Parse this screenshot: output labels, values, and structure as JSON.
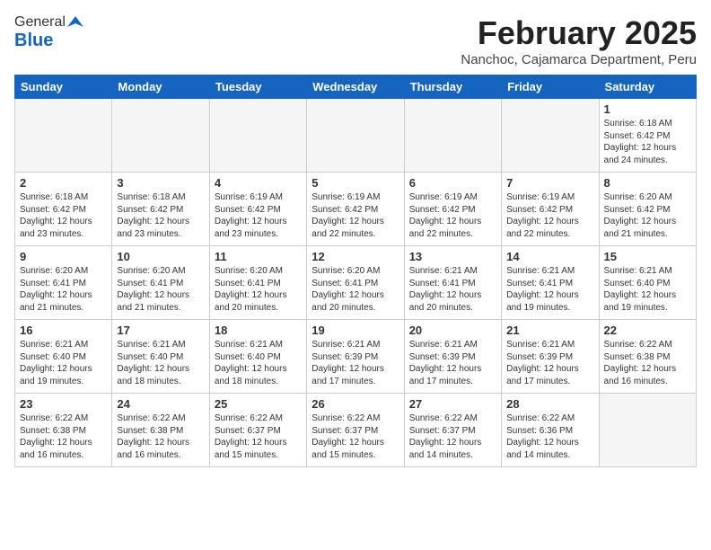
{
  "logo": {
    "general": "General",
    "blue": "Blue"
  },
  "header": {
    "month_title": "February 2025",
    "location": "Nanchoc, Cajamarca Department, Peru"
  },
  "weekdays": [
    "Sunday",
    "Monday",
    "Tuesday",
    "Wednesday",
    "Thursday",
    "Friday",
    "Saturday"
  ],
  "weeks": [
    [
      {
        "date": "",
        "info": ""
      },
      {
        "date": "",
        "info": ""
      },
      {
        "date": "",
        "info": ""
      },
      {
        "date": "",
        "info": ""
      },
      {
        "date": "",
        "info": ""
      },
      {
        "date": "",
        "info": ""
      },
      {
        "date": "1",
        "info": "Sunrise: 6:18 AM\nSunset: 6:42 PM\nDaylight: 12 hours and 24 minutes."
      }
    ],
    [
      {
        "date": "2",
        "info": "Sunrise: 6:18 AM\nSunset: 6:42 PM\nDaylight: 12 hours and 23 minutes."
      },
      {
        "date": "3",
        "info": "Sunrise: 6:18 AM\nSunset: 6:42 PM\nDaylight: 12 hours and 23 minutes."
      },
      {
        "date": "4",
        "info": "Sunrise: 6:19 AM\nSunset: 6:42 PM\nDaylight: 12 hours and 23 minutes."
      },
      {
        "date": "5",
        "info": "Sunrise: 6:19 AM\nSunset: 6:42 PM\nDaylight: 12 hours and 22 minutes."
      },
      {
        "date": "6",
        "info": "Sunrise: 6:19 AM\nSunset: 6:42 PM\nDaylight: 12 hours and 22 minutes."
      },
      {
        "date": "7",
        "info": "Sunrise: 6:19 AM\nSunset: 6:42 PM\nDaylight: 12 hours and 22 minutes."
      },
      {
        "date": "8",
        "info": "Sunrise: 6:20 AM\nSunset: 6:42 PM\nDaylight: 12 hours and 21 minutes."
      }
    ],
    [
      {
        "date": "9",
        "info": "Sunrise: 6:20 AM\nSunset: 6:41 PM\nDaylight: 12 hours and 21 minutes."
      },
      {
        "date": "10",
        "info": "Sunrise: 6:20 AM\nSunset: 6:41 PM\nDaylight: 12 hours and 21 minutes."
      },
      {
        "date": "11",
        "info": "Sunrise: 6:20 AM\nSunset: 6:41 PM\nDaylight: 12 hours and 20 minutes."
      },
      {
        "date": "12",
        "info": "Sunrise: 6:20 AM\nSunset: 6:41 PM\nDaylight: 12 hours and 20 minutes."
      },
      {
        "date": "13",
        "info": "Sunrise: 6:21 AM\nSunset: 6:41 PM\nDaylight: 12 hours and 20 minutes."
      },
      {
        "date": "14",
        "info": "Sunrise: 6:21 AM\nSunset: 6:41 PM\nDaylight: 12 hours and 19 minutes."
      },
      {
        "date": "15",
        "info": "Sunrise: 6:21 AM\nSunset: 6:40 PM\nDaylight: 12 hours and 19 minutes."
      }
    ],
    [
      {
        "date": "16",
        "info": "Sunrise: 6:21 AM\nSunset: 6:40 PM\nDaylight: 12 hours and 19 minutes."
      },
      {
        "date": "17",
        "info": "Sunrise: 6:21 AM\nSunset: 6:40 PM\nDaylight: 12 hours and 18 minutes."
      },
      {
        "date": "18",
        "info": "Sunrise: 6:21 AM\nSunset: 6:40 PM\nDaylight: 12 hours and 18 minutes."
      },
      {
        "date": "19",
        "info": "Sunrise: 6:21 AM\nSunset: 6:39 PM\nDaylight: 12 hours and 17 minutes."
      },
      {
        "date": "20",
        "info": "Sunrise: 6:21 AM\nSunset: 6:39 PM\nDaylight: 12 hours and 17 minutes."
      },
      {
        "date": "21",
        "info": "Sunrise: 6:21 AM\nSunset: 6:39 PM\nDaylight: 12 hours and 17 minutes."
      },
      {
        "date": "22",
        "info": "Sunrise: 6:22 AM\nSunset: 6:38 PM\nDaylight: 12 hours and 16 minutes."
      }
    ],
    [
      {
        "date": "23",
        "info": "Sunrise: 6:22 AM\nSunset: 6:38 PM\nDaylight: 12 hours and 16 minutes."
      },
      {
        "date": "24",
        "info": "Sunrise: 6:22 AM\nSunset: 6:38 PM\nDaylight: 12 hours and 16 minutes."
      },
      {
        "date": "25",
        "info": "Sunrise: 6:22 AM\nSunset: 6:37 PM\nDaylight: 12 hours and 15 minutes."
      },
      {
        "date": "26",
        "info": "Sunrise: 6:22 AM\nSunset: 6:37 PM\nDaylight: 12 hours and 15 minutes."
      },
      {
        "date": "27",
        "info": "Sunrise: 6:22 AM\nSunset: 6:37 PM\nDaylight: 12 hours and 14 minutes."
      },
      {
        "date": "28",
        "info": "Sunrise: 6:22 AM\nSunset: 6:36 PM\nDaylight: 12 hours and 14 minutes."
      },
      {
        "date": "",
        "info": ""
      }
    ]
  ]
}
